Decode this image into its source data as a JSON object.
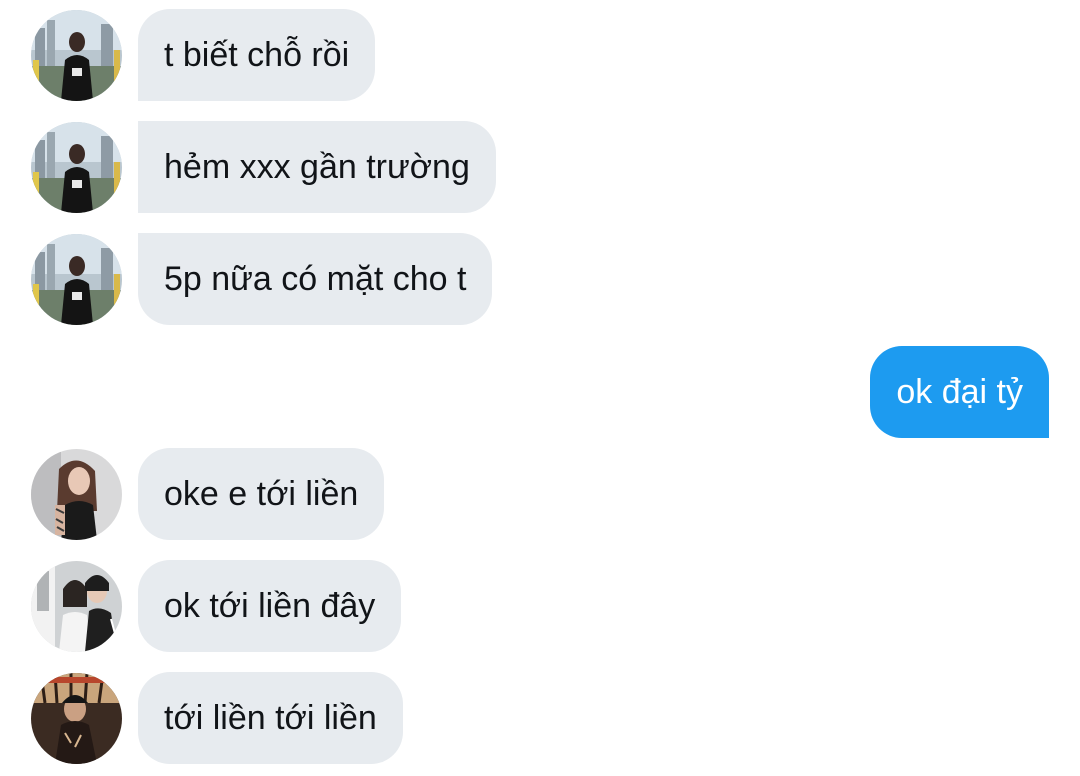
{
  "messages": [
    {
      "text": "t biết chỗ rồi",
      "direction": "in",
      "avatar": "avatar-girl-city-icon"
    },
    {
      "text": "hẻm xxx gần trường",
      "direction": "in",
      "avatar": "avatar-girl-city-icon"
    },
    {
      "text": "5p nữa có mặt cho t",
      "direction": "in",
      "avatar": "avatar-girl-city-icon"
    },
    {
      "text": "ok đại tỷ",
      "direction": "out"
    },
    {
      "text": "oke e tới liền",
      "direction": "in",
      "avatar": "avatar-girl-tattoo-icon"
    },
    {
      "text": "ok tới liền đây",
      "direction": "in",
      "avatar": "avatar-two-girls-icon"
    },
    {
      "text": "tới liền tới liền",
      "direction": "in",
      "avatar": "avatar-guy-beanie-icon"
    }
  ],
  "colors": {
    "incoming_bubble": "#e7ebef",
    "outgoing_bubble": "#1d9bf0",
    "incoming_text": "#111418",
    "outgoing_text": "#ffffff"
  }
}
